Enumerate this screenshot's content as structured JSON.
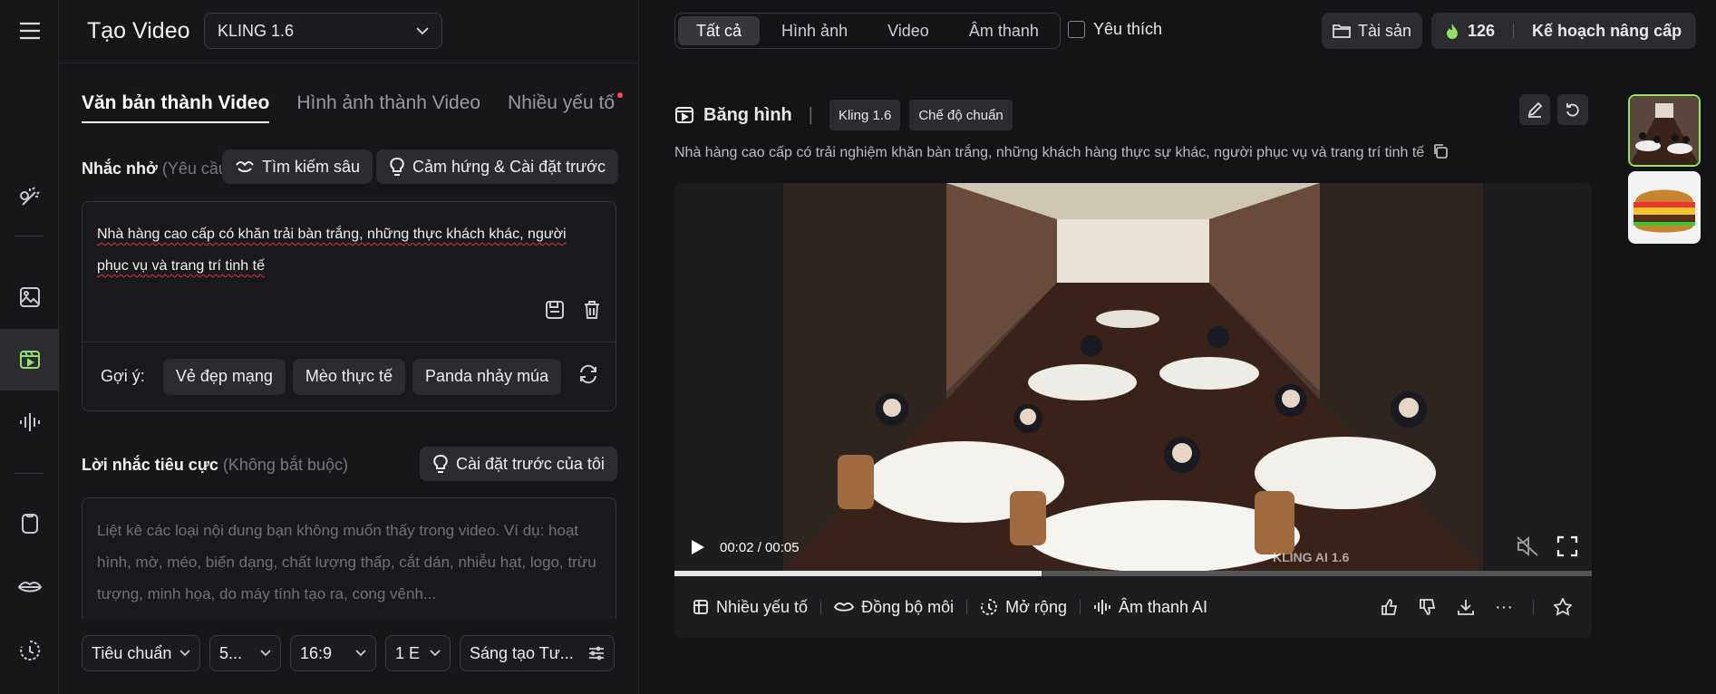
{
  "app": {
    "title": "Tạo Video",
    "model": "KLING 1.6"
  },
  "tabs": [
    "Văn bản thành Video",
    "Hình ảnh thành Video",
    "Nhiều yếu tố"
  ],
  "prompt": {
    "label": "Nhắc nhở",
    "hint": "(Yêu cầu)",
    "deep_search": "Tìm kiếm sâu",
    "inspiration": "Cảm hứng & Cài đặt trước",
    "text": "Nhà hàng cao cấp có khăn trải bàn trắng, những thực khách khác, người phục vụ và trang trí tinh tế",
    "suggest_label": "Gợi ý:",
    "suggestions": [
      "Vẻ đẹp mạng",
      "Mèo thực tế",
      "Panda nhảy múa"
    ]
  },
  "negative": {
    "label": "Lời nhắc tiêu cực",
    "hint": "(Không bắt buộc)",
    "preset": "Cài đặt trước của tôi",
    "placeholder": "Liệt kê các loại nội dung bạn không muốn thấy trong video. Ví dụ: hoạt hình, mờ, méo, biến dạng, chất lượng thấp, cắt dán, nhiễu hạt, logo, trừu tượng, minh họa, do máy tính tạo ra, cong vênh..."
  },
  "settings": {
    "quality": "Tiêu chuẩn",
    "duration": "5...",
    "ratio": "16:9",
    "count": "1 E",
    "creative": "Sáng tạo Tư..."
  },
  "filters": [
    "Tất cả",
    "Hình ảnh",
    "Video",
    "Âm thanh"
  ],
  "favorite": "Yêu thích",
  "assets": "Tài sản",
  "credits": "126",
  "upgrade": "Kế hoạch nâng cấp",
  "card": {
    "title": "Băng hình",
    "model_badge": "Kling 1.6",
    "mode_badge": "Chế độ chuẩn",
    "description": "Nhà hàng cao cấp có trải nghiệm khăn bàn trắng, những khách hàng thực sự khác, người phục vụ và trang trí tinh tế",
    "time": "00:02 / 00:05",
    "watermark": "KLING AI 1.6",
    "progress_fraction": 0.4,
    "actions": [
      "Nhiều yếu tố",
      "Đồng bộ môi",
      "Mở rộng",
      "Âm thanh AI"
    ]
  },
  "colors": {
    "accent": "#8fe36a",
    "bg": "#141416",
    "panel": "#17171a"
  }
}
